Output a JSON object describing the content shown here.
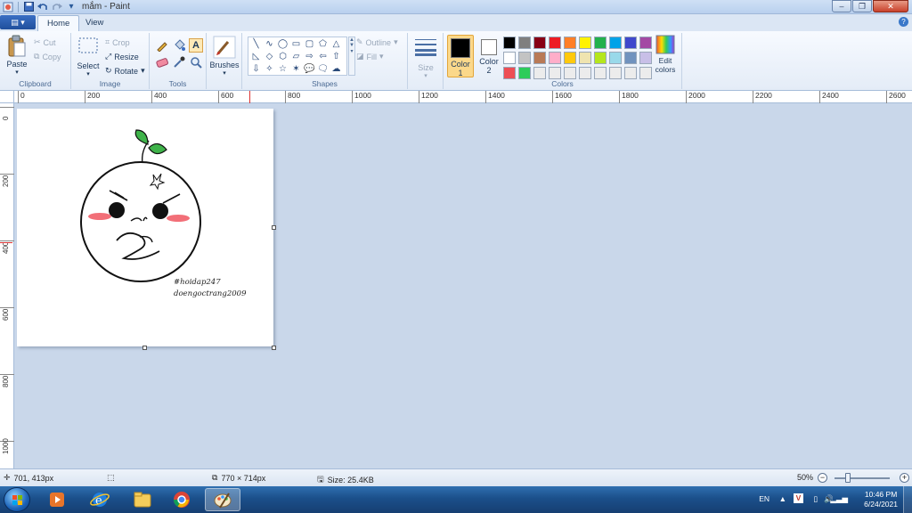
{
  "window": {
    "title": "mắm - Paint",
    "controls": {
      "minimize": "–",
      "maximize": "❐",
      "close": "✕"
    }
  },
  "quick_access": [
    "save-icon",
    "undo-icon",
    "redo-icon",
    "customize-icon"
  ],
  "tabs": [
    {
      "label": "Home",
      "active": true
    },
    {
      "label": "View",
      "active": false
    }
  ],
  "help_label": "?",
  "ribbon": {
    "clipboard": {
      "label": "Clipboard",
      "paste": "Paste",
      "cut": "Cut",
      "copy": "Copy"
    },
    "image": {
      "label": "Image",
      "select": "Select",
      "crop": "Crop",
      "resize": "Resize",
      "rotate": "Rotate"
    },
    "tools": {
      "label": "Tools",
      "items": [
        "pencil-icon",
        "fill-icon",
        "text-icon",
        "eraser-icon",
        "color-picker-icon",
        "magnifier-icon"
      ]
    },
    "brushes": {
      "label": "Brushes"
    },
    "shapes": {
      "label": "Shapes",
      "outline": "Outline",
      "fill": "Fill",
      "glyphs": [
        "╲",
        "∿",
        "◯",
        "▭",
        "▢",
        "⬠",
        "△",
        "◺",
        "◇",
        "⬡",
        "▱",
        "⇨",
        "⇦",
        "⇧",
        "⇩",
        "✧",
        "☆",
        "✶",
        "💬",
        "🗨",
        "☁"
      ]
    },
    "size": {
      "label": "Size"
    },
    "colors": {
      "label": "Colors",
      "color1": "Color",
      "color1_num": "1",
      "color2": "Color",
      "color2_num": "2",
      "color1_value": "#000000",
      "color2_value": "#ffffff",
      "edit": "Edit colors",
      "palette": [
        "#000000",
        "#7f7f7f",
        "#880015",
        "#ed1c24",
        "#ff7f27",
        "#fff200",
        "#22b14c",
        "#00a2e8",
        "#3f48cc",
        "#a349a4",
        "#ffffff",
        "#c3c3c3",
        "#b97a57",
        "#ffaec9",
        "#ffc90e",
        "#efe4b0",
        "#b5e61d",
        "#99d9ea",
        "#7092be",
        "#c8bfe7",
        "#ed4e54",
        "#2dcc5a",
        "#ececec",
        "#ececec",
        "#ececec",
        "#ececec",
        "#ececec",
        "#ececec",
        "#ececec",
        "#ececec"
      ]
    }
  },
  "ruler": {
    "h_labels": [
      "0",
      "200",
      "400",
      "600",
      "800",
      "1000",
      "1200",
      "1400",
      "1600",
      "1800",
      "2000",
      "2200",
      "2400",
      "2600"
    ],
    "v_labels": [
      "0",
      "200",
      "400",
      "600",
      "800",
      "1000"
    ]
  },
  "drawing": {
    "hashtag": "#hoidap247",
    "author": "doengoctrang2009"
  },
  "status": {
    "cursor_pos": "701, 413px",
    "image_size": "770 × 714px",
    "file_size": "Size: 25.4KB",
    "zoom": "50%",
    "zoom_percent": 50
  },
  "taskbar": {
    "apps": [
      "media-player-icon",
      "internet-explorer-icon",
      "file-explorer-icon",
      "chrome-icon",
      "paint-icon"
    ],
    "lang": "EN",
    "time": "10:46 PM",
    "date": "6/24/2021"
  }
}
